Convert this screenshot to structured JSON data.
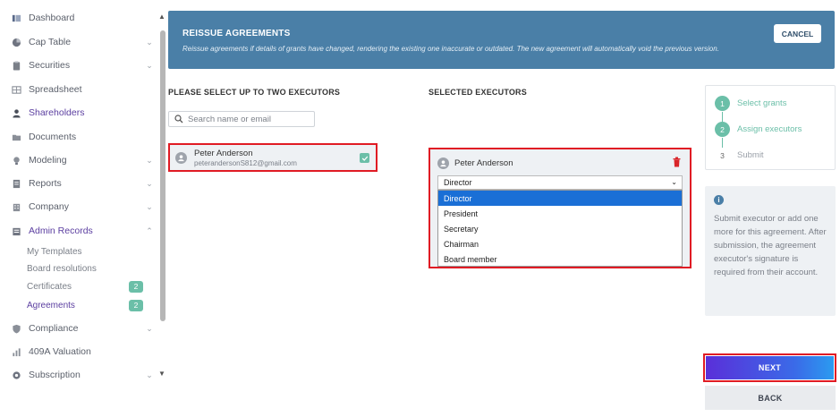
{
  "sidebar": {
    "items": [
      {
        "label": "Dashboard",
        "icon": "dashboard-icon"
      },
      {
        "label": "Cap Table",
        "icon": "pie-chart-icon"
      },
      {
        "label": "Securities",
        "icon": "clipboard-icon"
      },
      {
        "label": "Spreadsheet",
        "icon": "grid-icon"
      },
      {
        "label": "Shareholders",
        "icon": "person-icon"
      },
      {
        "label": "Documents",
        "icon": "folder-icon"
      },
      {
        "label": "Modeling",
        "icon": "bulb-icon"
      },
      {
        "label": "Reports",
        "icon": "report-icon"
      },
      {
        "label": "Company",
        "icon": "building-icon"
      },
      {
        "label": "Admin Records",
        "icon": "admin-icon"
      },
      {
        "label": "Compliance",
        "icon": "shield-icon"
      },
      {
        "label": "409A Valuation",
        "icon": "bar-chart-icon"
      },
      {
        "label": "Subscription",
        "icon": "gear-icon"
      }
    ],
    "sub_items": [
      {
        "label": "My Templates",
        "badge": ""
      },
      {
        "label": "Board resolutions",
        "badge": ""
      },
      {
        "label": "Certificates",
        "badge": "2"
      },
      {
        "label": "Agreements",
        "badge": "2"
      }
    ]
  },
  "banner": {
    "title": "REISSUE AGREEMENTS",
    "description": "Reissue agreements if details of grants have changed, rendering the existing one inaccurate or outdated. The new agreement will automatically void the previous version.",
    "cancel_label": "CANCEL"
  },
  "executors": {
    "title": "PLEASE SELECT UP TO TWO EXECUTORS",
    "search_placeholder": "Search name or email",
    "list": [
      {
        "name": "Peter Anderson",
        "email": "peterandersonS812@gmail.com",
        "checked": true
      }
    ]
  },
  "selected": {
    "title": "SELECTED EXECUTORS",
    "name": "Peter Anderson",
    "role_value": "Director",
    "options": [
      "Director",
      "President",
      "Secretary",
      "Chairman",
      "Board member"
    ]
  },
  "steps": [
    {
      "num": "1",
      "label": "Select grants",
      "state": "done"
    },
    {
      "num": "2",
      "label": "Assign executors",
      "state": "done"
    },
    {
      "num": "3",
      "label": "Submit",
      "state": "todo"
    }
  ],
  "info": {
    "icon": "info-icon",
    "text": "Submit executor or add one more for this agreement. After submission, the agreement executor's signature is required from their account."
  },
  "buttons": {
    "next": "NEXT",
    "back": "BACK"
  },
  "colors": {
    "accent": "#5b3ea0",
    "banner": "#4a7fa7",
    "success": "#6bbfa8",
    "highlight": "#e01b24",
    "option_selected": "#1a6fd6"
  }
}
